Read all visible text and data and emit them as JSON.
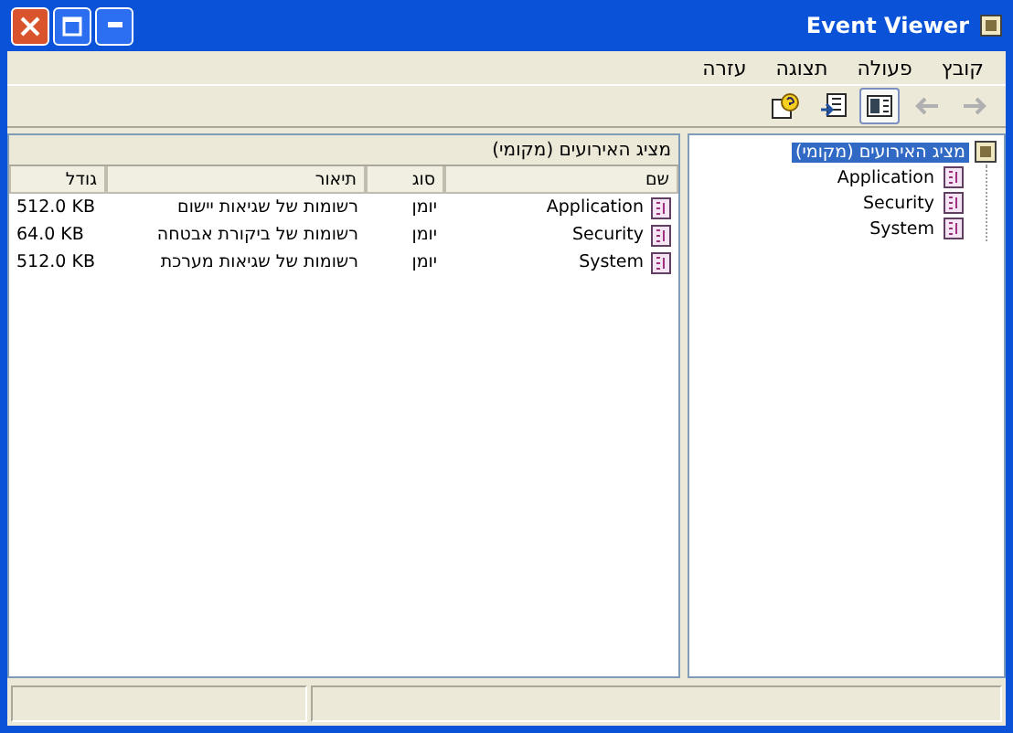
{
  "window": {
    "title": "Event Viewer"
  },
  "menu": [
    {
      "label": "קובץ"
    },
    {
      "label": "פעולה"
    },
    {
      "label": "תצוגה"
    },
    {
      "label": "עזרה"
    }
  ],
  "toolbar": [
    {
      "kind": "forward",
      "disabled": true,
      "pressed": false
    },
    {
      "kind": "back",
      "disabled": true,
      "pressed": false
    },
    {
      "kind": "tree-toggle",
      "disabled": false,
      "pressed": true
    },
    {
      "kind": "export",
      "disabled": false,
      "pressed": false
    },
    {
      "kind": "help",
      "disabled": false,
      "pressed": false
    }
  ],
  "tree": [
    {
      "label": "מציג האירועים (מקומי)",
      "selected": true,
      "expanded": true,
      "children": [
        {
          "label": "Application",
          "selected": false
        },
        {
          "label": "Security",
          "selected": false
        },
        {
          "label": "System",
          "selected": false
        }
      ]
    }
  ],
  "list": {
    "header": "מציג האירועים (מקומי)",
    "columns": [
      "שם",
      "סוג",
      "תיאור",
      "גודל"
    ],
    "rows": [
      {
        "name": "Application",
        "type": "יומן",
        "description": "רשומות של שגיאות יישום",
        "size": "512.0 KB"
      },
      {
        "name": "Security",
        "type": "יומן",
        "description": "רשומות של ביקורת אבטחה",
        "size": "64.0 KB"
      },
      {
        "name": "System",
        "type": "יומן",
        "description": "רשומות של שגיאות מערכת",
        "size": "512.0 KB"
      }
    ]
  }
}
